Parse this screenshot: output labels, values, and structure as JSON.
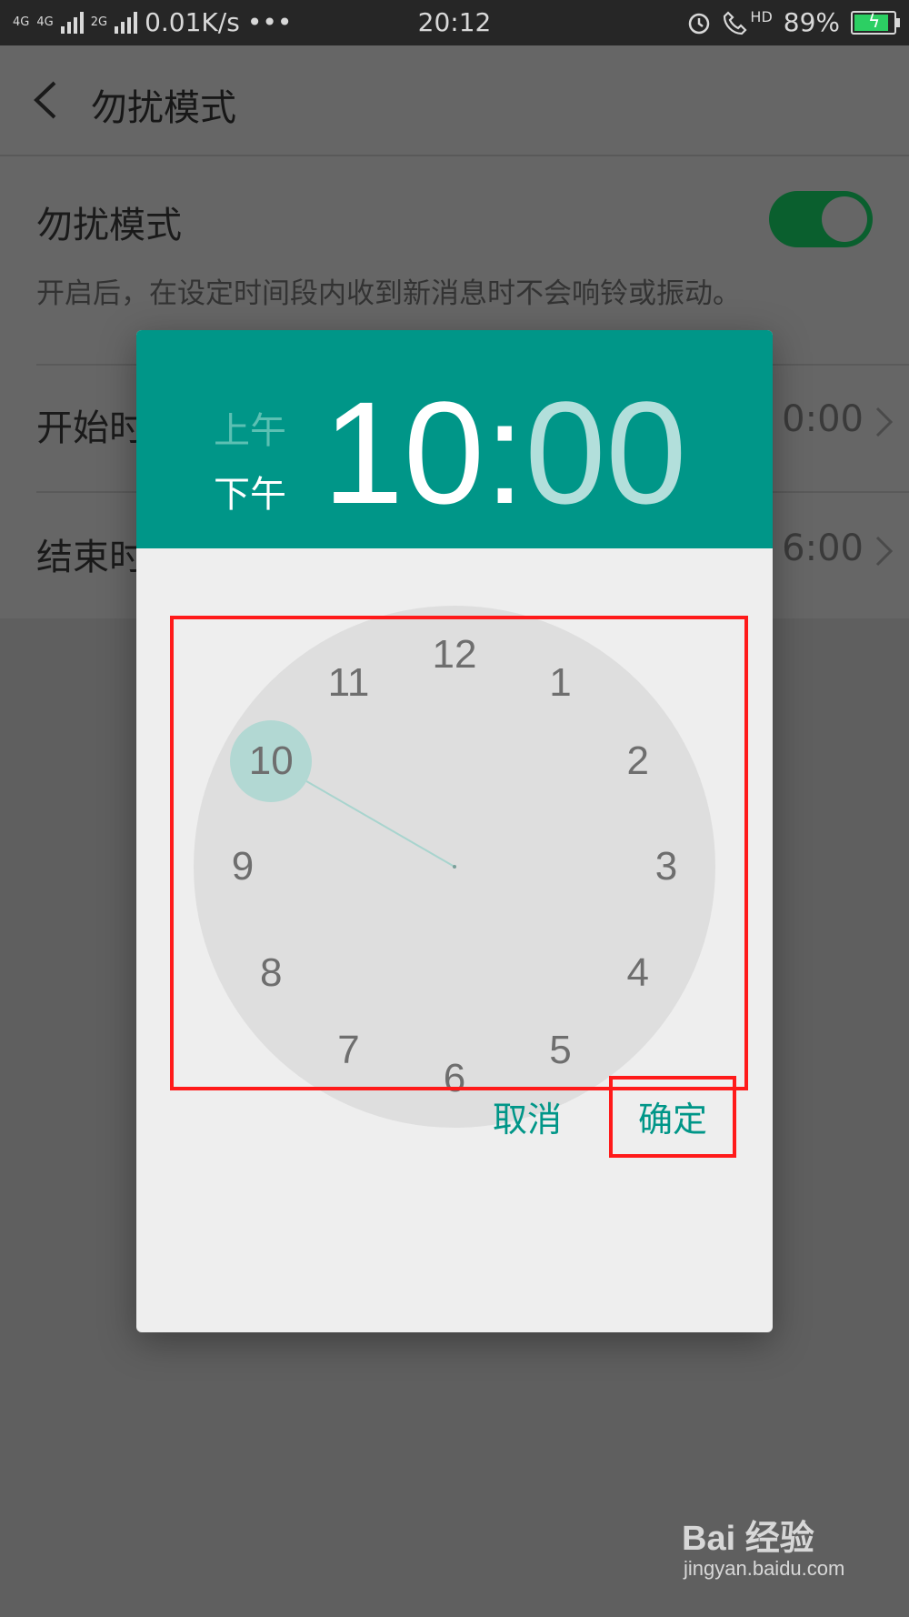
{
  "status_bar": {
    "net1": "4G",
    "net2": "4G",
    "net3": "2G",
    "speed": "0.01K/s",
    "more": "•••",
    "time": "20:12",
    "hd": "HD",
    "battery": "89%",
    "battery_level": 0.89,
    "battery_color": "#2ccf63"
  },
  "page": {
    "title": "勿扰模式",
    "dnd_label": "勿扰模式",
    "dnd_enabled": true,
    "dnd_description": "开启后，在设定时间段内收到新消息时不会响铃或振动。",
    "start_label": "开始时",
    "start_value": "0:00",
    "end_label": "结束时",
    "end_value": "6:00"
  },
  "time_picker": {
    "am_label": "上午",
    "pm_label": "下午",
    "selected_period": "下午",
    "hour": "10",
    "separator": ":",
    "minute": "00",
    "accent_color": "#009688",
    "clock_numbers": [
      "12",
      "1",
      "2",
      "3",
      "4",
      "5",
      "6",
      "7",
      "8",
      "9",
      "10",
      "11"
    ],
    "selected_number": "10",
    "cancel_label": "取消",
    "ok_label": "确定"
  },
  "watermark": {
    "brand": "Bai 经验",
    "url": "jingyan.baidu.com"
  }
}
